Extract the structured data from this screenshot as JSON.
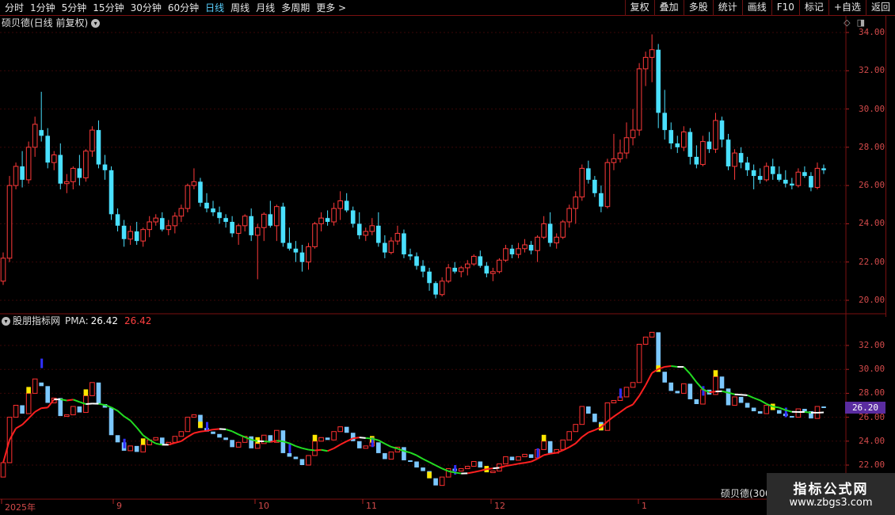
{
  "toolbar": {
    "periods": [
      "分时",
      "1分钟",
      "5分钟",
      "15分钟",
      "30分钟",
      "60分钟",
      "日线",
      "周线",
      "月线",
      "多周期",
      "更多 >"
    ],
    "active_period": "日线",
    "buttons": [
      "复权",
      "叠加",
      "多股",
      "统计",
      "画线",
      "F10",
      "标记",
      "+自选",
      "返回"
    ]
  },
  "main_panel": {
    "title": "硕贝德(日线 前复权)",
    "price_labels": [
      "34.00",
      "32.00",
      "30.00",
      "28.00",
      "26.00",
      "24.00",
      "22.00",
      "20.00"
    ]
  },
  "indicator_panel": {
    "name": "股朋指标网",
    "label": "PMA:",
    "value": "26.42",
    "value2": "26.42",
    "price_labels": [
      "32.00",
      "30.00",
      "28.00",
      "26.00",
      "24.00",
      "22.00"
    ],
    "current_price": "26.20"
  },
  "date_axis": [
    "2025年",
    "9",
    "10",
    "11",
    "12",
    "1"
  ],
  "stock_tip": "硕贝德(300",
  "watermark": {
    "line1": "指标公式网",
    "line2": "www.zbgs3.com"
  },
  "colors": {
    "up": "#ff3a3a",
    "down": "#4ae0ff",
    "ma_up": "#ff2020",
    "ma_down": "#22dd22",
    "grid": "#3a0808"
  },
  "chart_data": {
    "type": "candlestick",
    "title": "硕贝德(日线 前复权)",
    "ylim": [
      19.5,
      35.0
    ],
    "note_period": "daily",
    "series": [
      {
        "name": "PMA",
        "last": 26.42
      }
    ],
    "candles": [
      [
        21.0,
        22.5,
        20.8,
        22.2
      ],
      [
        22.2,
        26.5,
        22.0,
        26.0
      ],
      [
        26.0,
        27.2,
        25.8,
        27.0
      ],
      [
        27.0,
        27.8,
        25.9,
        26.3
      ],
      [
        26.3,
        28.3,
        26.1,
        28.0
      ],
      [
        28.0,
        29.6,
        27.5,
        29.2
      ],
      [
        28.9,
        30.9,
        28.3,
        28.6
      ],
      [
        28.6,
        29.0,
        26.9,
        27.2
      ],
      [
        27.2,
        27.8,
        26.8,
        27.6
      ],
      [
        27.6,
        28.2,
        25.8,
        26.1
      ],
      [
        26.1,
        26.6,
        25.6,
        26.2
      ],
      [
        26.2,
        27.0,
        25.8,
        26.9
      ],
      [
        26.9,
        27.6,
        26.0,
        26.4
      ],
      [
        26.4,
        27.9,
        26.2,
        27.8
      ],
      [
        27.8,
        29.1,
        27.5,
        28.9
      ],
      [
        28.9,
        29.4,
        26.9,
        27.1
      ],
      [
        27.1,
        27.6,
        26.3,
        26.8
      ],
      [
        26.8,
        27.0,
        24.2,
        24.5
      ],
      [
        24.5,
        24.8,
        23.6,
        23.9
      ],
      [
        23.9,
        24.2,
        22.8,
        23.2
      ],
      [
        23.2,
        23.9,
        22.9,
        23.6
      ],
      [
        23.6,
        24.1,
        22.9,
        23.1
      ],
      [
        23.1,
        23.8,
        22.8,
        23.7
      ],
      [
        23.7,
        24.4,
        23.3,
        24.1
      ],
      [
        24.1,
        24.5,
        23.9,
        24.3
      ],
      [
        24.3,
        24.6,
        23.6,
        23.7
      ],
      [
        23.7,
        24.2,
        23.4,
        23.9
      ],
      [
        23.9,
        24.6,
        23.5,
        24.4
      ],
      [
        24.4,
        25.0,
        24.1,
        24.8
      ],
      [
        24.8,
        26.1,
        24.6,
        26.0
      ],
      [
        26.0,
        26.9,
        25.8,
        26.2
      ],
      [
        26.2,
        26.4,
        24.9,
        25.1
      ],
      [
        25.1,
        25.6,
        24.6,
        24.8
      ],
      [
        24.8,
        25.2,
        24.4,
        24.6
      ],
      [
        24.6,
        24.9,
        24.0,
        24.3
      ],
      [
        24.3,
        24.5,
        23.8,
        24.1
      ],
      [
        24.1,
        24.4,
        23.3,
        23.5
      ],
      [
        23.5,
        24.0,
        22.9,
        23.9
      ],
      [
        23.9,
        24.5,
        23.6,
        24.4
      ],
      [
        24.4,
        24.8,
        23.1,
        23.4
      ],
      [
        23.4,
        24.0,
        21.1,
        23.8
      ],
      [
        23.8,
        24.6,
        23.1,
        24.5
      ],
      [
        24.5,
        25.2,
        23.8,
        23.9
      ],
      [
        23.9,
        25.0,
        23.1,
        24.9
      ],
      [
        24.9,
        25.1,
        22.8,
        23.0
      ],
      [
        23.0,
        23.8,
        22.6,
        22.7
      ],
      [
        22.7,
        23.1,
        22.0,
        22.5
      ],
      [
        22.5,
        22.9,
        21.5,
        22.0
      ],
      [
        22.0,
        23.0,
        21.6,
        22.8
      ],
      [
        22.8,
        24.1,
        22.7,
        24.0
      ],
      [
        24.0,
        24.6,
        23.6,
        24.3
      ],
      [
        24.3,
        24.7,
        23.9,
        24.1
      ],
      [
        24.1,
        25.1,
        23.9,
        24.8
      ],
      [
        24.8,
        25.7,
        24.2,
        25.2
      ],
      [
        25.2,
        25.6,
        24.6,
        24.7
      ],
      [
        24.7,
        24.9,
        23.8,
        24.0
      ],
      [
        24.0,
        24.6,
        23.2,
        23.4
      ],
      [
        23.4,
        23.8,
        23.1,
        23.6
      ],
      [
        23.6,
        24.3,
        23.4,
        23.9
      ],
      [
        23.9,
        24.6,
        22.8,
        23.0
      ],
      [
        23.0,
        23.4,
        22.2,
        22.5
      ],
      [
        22.5,
        23.3,
        22.4,
        23.1
      ],
      [
        23.1,
        23.9,
        22.9,
        23.5
      ],
      [
        23.5,
        23.7,
        22.2,
        22.4
      ],
      [
        22.4,
        22.7,
        22.1,
        22.3
      ],
      [
        22.3,
        22.5,
        21.6,
        21.8
      ],
      [
        21.8,
        22.1,
        21.2,
        21.5
      ],
      [
        21.5,
        21.7,
        20.5,
        20.9
      ],
      [
        20.9,
        21.0,
        20.1,
        20.3
      ],
      [
        20.3,
        21.2,
        20.2,
        21.0
      ],
      [
        21.0,
        21.9,
        20.9,
        21.7
      ],
      [
        21.7,
        22.0,
        21.4,
        21.5
      ],
      [
        21.5,
        21.8,
        21.2,
        21.7
      ],
      [
        21.7,
        22.1,
        21.3,
        21.9
      ],
      [
        21.9,
        22.4,
        21.8,
        22.3
      ],
      [
        22.3,
        22.6,
        21.7,
        21.8
      ],
      [
        21.8,
        22.0,
        21.2,
        21.4
      ],
      [
        21.4,
        21.7,
        21.0,
        21.5
      ],
      [
        21.5,
        22.2,
        21.4,
        22.1
      ],
      [
        22.1,
        22.9,
        22.0,
        22.7
      ],
      [
        22.7,
        22.9,
        22.2,
        22.4
      ],
      [
        22.4,
        23.0,
        22.2,
        22.7
      ],
      [
        22.7,
        23.2,
        22.5,
        22.9
      ],
      [
        22.9,
        23.1,
        22.4,
        22.6
      ],
      [
        22.6,
        23.4,
        22.0,
        23.3
      ],
      [
        23.3,
        24.4,
        23.2,
        24.0
      ],
      [
        24.0,
        24.6,
        22.8,
        23.0
      ],
      [
        23.0,
        23.5,
        22.7,
        23.3
      ],
      [
        23.3,
        24.2,
        23.2,
        24.1
      ],
      [
        24.1,
        25.0,
        23.8,
        24.8
      ],
      [
        24.8,
        25.7,
        24.0,
        25.4
      ],
      [
        25.4,
        27.1,
        25.2,
        26.9
      ],
      [
        26.9,
        27.3,
        26.1,
        26.3
      ],
      [
        26.3,
        26.5,
        25.4,
        25.6
      ],
      [
        25.6,
        26.0,
        24.6,
        24.9
      ],
      [
        24.9,
        27.4,
        24.8,
        27.2
      ],
      [
        27.2,
        28.7,
        26.8,
        27.4
      ],
      [
        27.4,
        28.4,
        27.2,
        27.7
      ],
      [
        27.7,
        29.3,
        27.4,
        28.5
      ],
      [
        28.5,
        30.0,
        28.1,
        28.9
      ],
      [
        28.9,
        32.4,
        28.6,
        32.1
      ],
      [
        32.1,
        33.0,
        31.2,
        32.7
      ],
      [
        32.7,
        33.9,
        31.4,
        33.1
      ],
      [
        33.1,
        33.4,
        29.0,
        29.8
      ],
      [
        29.8,
        31.0,
        28.4,
        28.9
      ],
      [
        28.9,
        29.3,
        27.9,
        28.2
      ],
      [
        28.2,
        28.6,
        27.7,
        28.0
      ],
      [
        28.0,
        29.1,
        27.8,
        28.8
      ],
      [
        28.8,
        29.0,
        27.1,
        27.5
      ],
      [
        27.5,
        28.1,
        26.9,
        27.1
      ],
      [
        27.1,
        28.6,
        27.0,
        28.3
      ],
      [
        28.3,
        28.8,
        27.7,
        27.9
      ],
      [
        27.9,
        29.8,
        27.7,
        29.4
      ],
      [
        29.4,
        29.6,
        28.0,
        28.4
      ],
      [
        28.4,
        28.7,
        26.8,
        27.0
      ],
      [
        27.0,
        27.9,
        26.3,
        27.7
      ],
      [
        27.7,
        28.0,
        26.9,
        27.2
      ],
      [
        27.2,
        27.5,
        26.5,
        26.8
      ],
      [
        26.8,
        27.1,
        25.8,
        26.5
      ],
      [
        26.5,
        26.9,
        26.1,
        26.3
      ],
      [
        26.3,
        27.2,
        26.2,
        27.0
      ],
      [
        27.0,
        27.4,
        26.3,
        26.6
      ],
      [
        26.6,
        27.0,
        26.2,
        26.3
      ],
      [
        26.3,
        26.8,
        25.9,
        26.1
      ],
      [
        26.1,
        26.4,
        25.8,
        26.0
      ],
      [
        26.0,
        26.9,
        25.9,
        26.7
      ],
      [
        26.7,
        27.0,
        26.4,
        26.5
      ],
      [
        26.5,
        26.7,
        25.7,
        25.9
      ],
      [
        25.9,
        27.2,
        25.8,
        26.9
      ],
      [
        26.9,
        27.1,
        26.6,
        26.8
      ]
    ]
  }
}
